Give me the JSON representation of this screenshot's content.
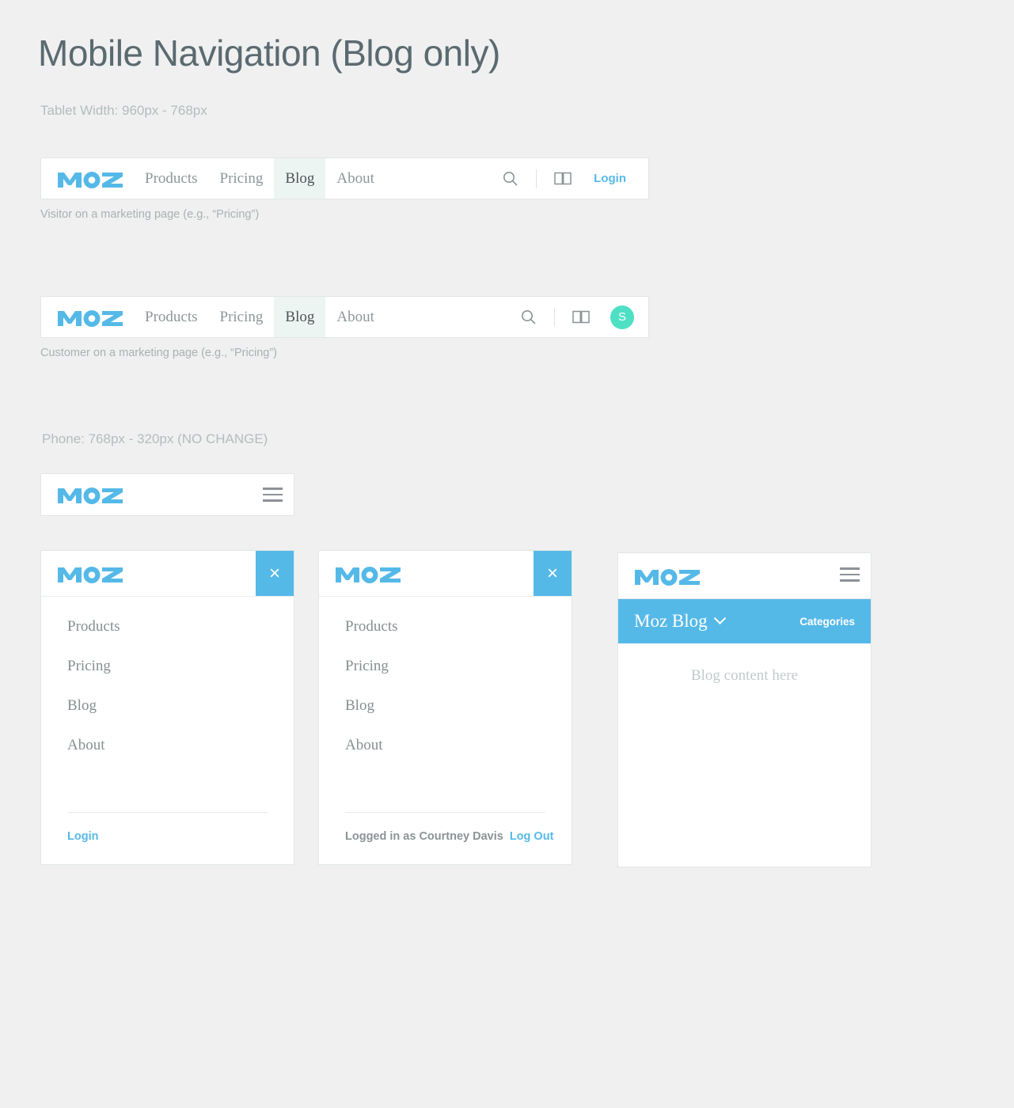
{
  "header": {
    "title": "Mobile Navigation (Blog only)",
    "tablet_label": "Tablet Width: 960px - 768px",
    "phone_label": "Phone: 768px - 320px (NO CHANGE)"
  },
  "brand": {
    "logo_text": "MOZ",
    "logo_color": "#55b9e8",
    "accent_blue": "#55b9e8",
    "avatar_green": "#4fe0c4",
    "active_tab_bg": "#edf5f2"
  },
  "tablet_navs": [
    {
      "caption": "Visitor on a marketing page (e.g., “Pricing”)",
      "links": [
        {
          "label": "Products",
          "active": false
        },
        {
          "label": "Pricing",
          "active": false
        },
        {
          "label": "Blog",
          "active": true
        },
        {
          "label": "About",
          "active": false
        }
      ],
      "search_icon": "search-icon",
      "book_icon": "book-icon",
      "account_type": "login",
      "login_label": "Login",
      "avatar_initial": ""
    },
    {
      "caption": "Customer on a marketing page (e.g., “Pricing”)",
      "links": [
        {
          "label": "Products",
          "active": false
        },
        {
          "label": "Pricing",
          "active": false
        },
        {
          "label": "Blog",
          "active": true
        },
        {
          "label": "About",
          "active": false
        }
      ],
      "search_icon": "search-icon",
      "book_icon": "book-icon",
      "account_type": "avatar",
      "login_label": "",
      "avatar_initial": "S"
    }
  ],
  "phone_bar": {
    "logo_text": "MOZ",
    "menu_icon": "hamburger-icon"
  },
  "panels": {
    "logged_out": {
      "close_label": "×",
      "menu": [
        {
          "label": "Products"
        },
        {
          "label": "Pricing"
        },
        {
          "label": "Blog"
        },
        {
          "label": "About"
        }
      ],
      "footer_login": "Login"
    },
    "logged_in": {
      "close_label": "×",
      "menu": [
        {
          "label": "Products"
        },
        {
          "label": "Pricing"
        },
        {
          "label": "Blog"
        },
        {
          "label": "About"
        }
      ],
      "footer_user": "Logged in as Courtney Davis",
      "footer_logout": "Log Out"
    },
    "blog": {
      "menu_icon": "hamburger-icon",
      "blog_title": "Moz Blog",
      "categories_label": "Categories",
      "content_placeholder": "Blog content here"
    }
  }
}
